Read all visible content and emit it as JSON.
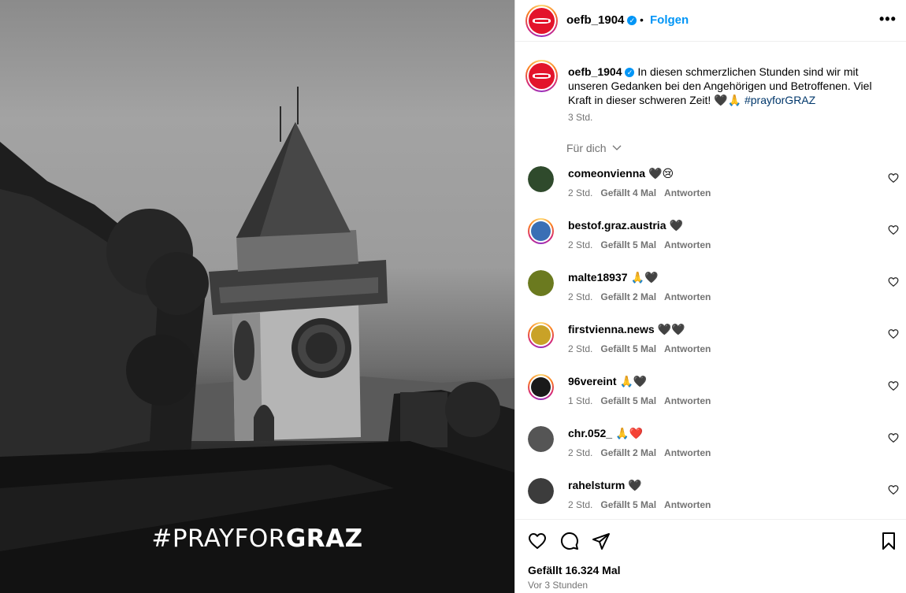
{
  "photo": {
    "caption_light": "#PRAYFOR",
    "caption_bold": "GRAZ"
  },
  "header": {
    "username": "oefb_1904",
    "verified_mark": "✓",
    "separator": "•",
    "follow_label": "Folgen",
    "more_label": "•••"
  },
  "post": {
    "username": "oefb_1904",
    "text": "In diesen schmerzlichen Stunden sind wir mit unseren Gedanken bei den Angehörigen und Betroffenen. Viel Kraft in dieser schweren Zeit! 🖤🙏",
    "hashtag": "#prayforGRAZ",
    "time": "3 Std."
  },
  "comments_filter": {
    "label": "Für dich",
    "icon": "chevron-down-icon"
  },
  "comments": [
    {
      "username": "comeonvienna",
      "emoji": "🖤😢",
      "time": "2 Std.",
      "likes": "Gefällt 4 Mal",
      "reply": "Antworten",
      "ring": false,
      "avatar_color": "#2f4a2c"
    },
    {
      "username": "bestof.graz.austria",
      "emoji": "🖤",
      "time": "2 Std.",
      "likes": "Gefällt 5 Mal",
      "reply": "Antworten",
      "ring": true,
      "avatar_color": "#3a6fb5"
    },
    {
      "username": "malte18937",
      "emoji": "🙏🖤",
      "time": "2 Std.",
      "likes": "Gefällt 2 Mal",
      "reply": "Antworten",
      "ring": false,
      "avatar_color": "#6b7a1f"
    },
    {
      "username": "firstvienna.news",
      "emoji": "🖤🖤",
      "time": "2 Std.",
      "likes": "Gefällt 5 Mal",
      "reply": "Antworten",
      "ring": true,
      "avatar_color": "#c9a227"
    },
    {
      "username": "96vereint",
      "emoji": "🙏🖤",
      "time": "1 Std.",
      "likes": "Gefällt 5 Mal",
      "reply": "Antworten",
      "ring": true,
      "avatar_color": "#1a1a1a"
    },
    {
      "username": "chr.052_",
      "emoji": "🙏❤️",
      "time": "2 Std.",
      "likes": "Gefällt 2 Mal",
      "reply": "Antworten",
      "ring": false,
      "avatar_color": "#555555"
    },
    {
      "username": "rahelsturm",
      "emoji": "🖤",
      "time": "2 Std.",
      "likes": "Gefällt 5 Mal",
      "reply": "Antworten",
      "ring": false,
      "avatar_color": "#3c3c3c"
    }
  ],
  "footer": {
    "likes": "Gefällt 16.324 Mal",
    "ago": "Vor 3 Stunden"
  },
  "colors": {
    "accent": "#0095f6",
    "brand": "#e3142b",
    "muted": "#737373"
  }
}
